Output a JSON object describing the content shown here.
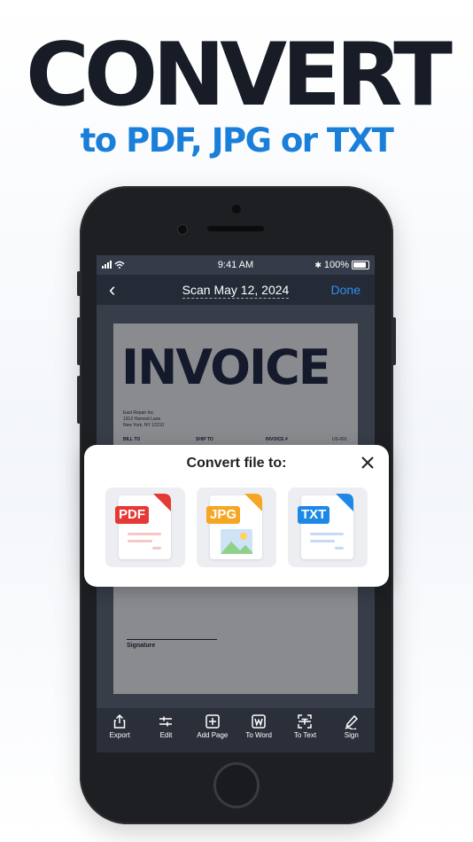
{
  "hero": {
    "headline": "CONVERT",
    "subline": "to PDF, JPG or TXT"
  },
  "status": {
    "time": "9:41 AM",
    "battery": "100%",
    "bluetooth": "✱"
  },
  "nav": {
    "back": "‹",
    "title": "Scan May 12, 2024",
    "done": "Done"
  },
  "document": {
    "title": "INVOICE",
    "company": [
      "East Repair Inc.",
      "1912 Harvest Lane",
      "New York, NY 12210"
    ],
    "bill_to": "BILL TO",
    "ship_to": "SHIP TO",
    "invoice_no_label": "INVOICE #",
    "invoice_no": "US-001",
    "signature": "Signature"
  },
  "modal": {
    "title": "Convert file to:",
    "options": [
      {
        "tag": "PDF",
        "color": "#e53935"
      },
      {
        "tag": "JPG",
        "color": "#f5a623"
      },
      {
        "tag": "TXT",
        "color": "#1e88e5"
      }
    ]
  },
  "toolbar": {
    "items": [
      {
        "label": "Export",
        "icon": "share-icon"
      },
      {
        "label": "Edit",
        "icon": "sliders-icon"
      },
      {
        "label": "Add Page",
        "icon": "plus-square-icon"
      },
      {
        "label": "To Word",
        "icon": "word-icon"
      },
      {
        "label": "To Text",
        "icon": "scan-text-icon"
      },
      {
        "label": "Sign",
        "icon": "pen-icon"
      }
    ]
  },
  "colors": {
    "accent": "#1a7fd9",
    "done": "#2f8ff5",
    "headline": "#171c26"
  }
}
